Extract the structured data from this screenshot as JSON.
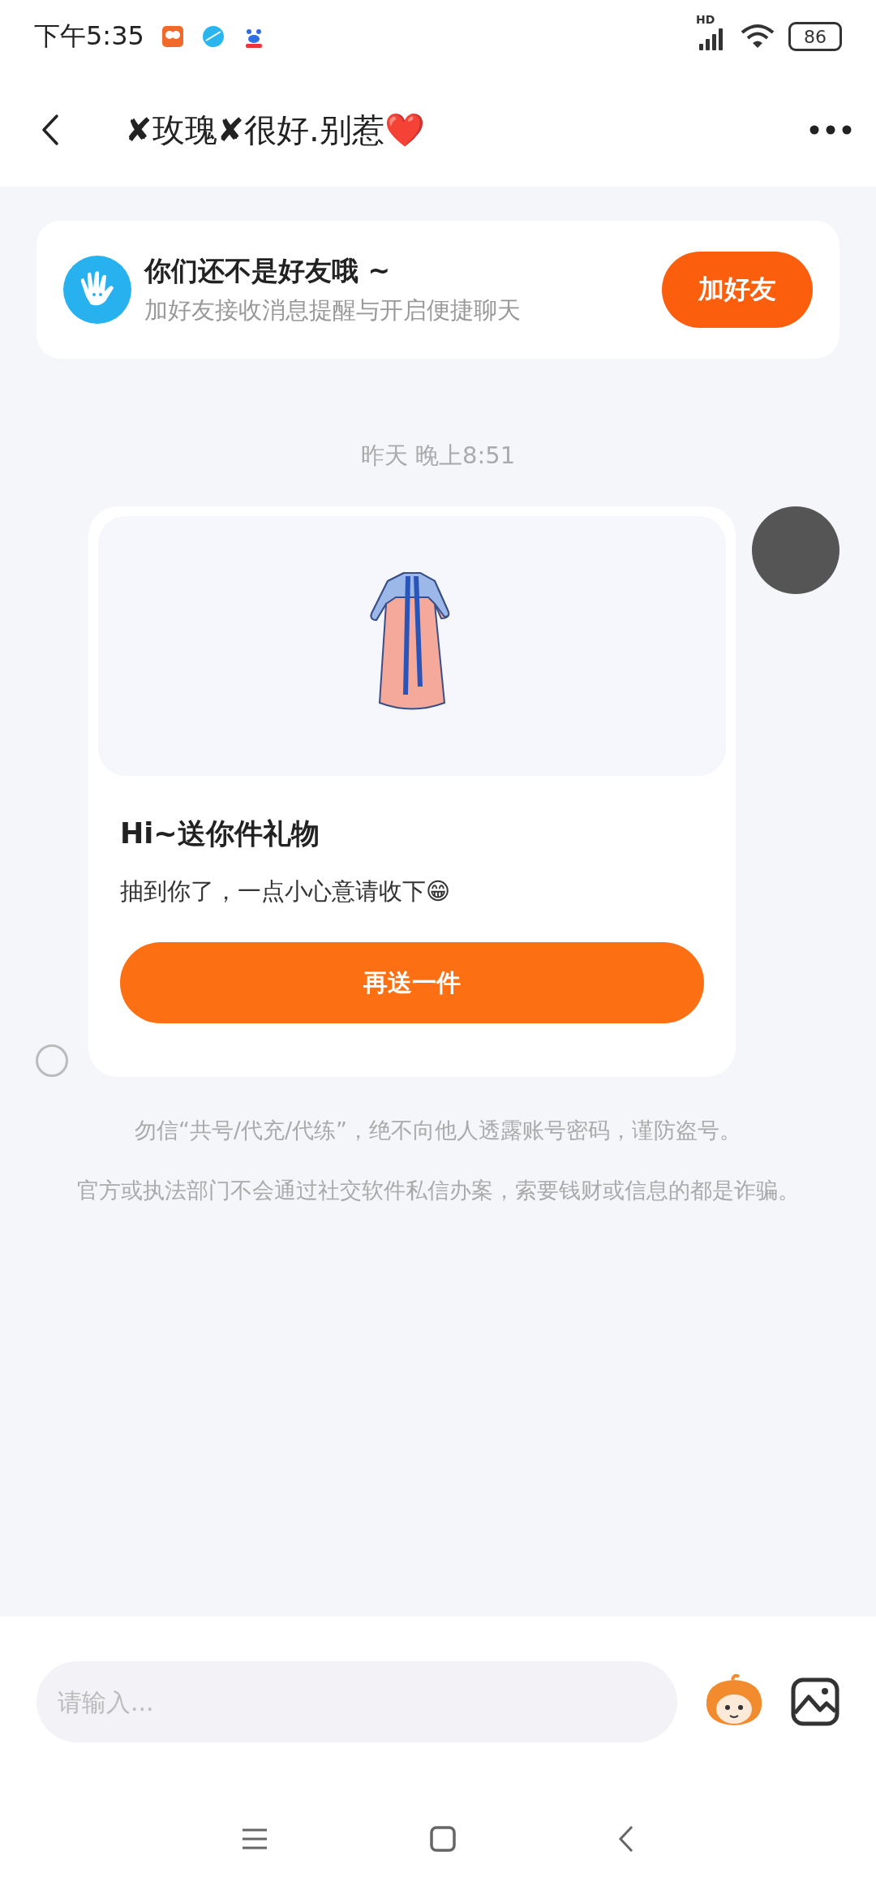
{
  "status_bar": {
    "time": "下午5:35",
    "network": "HD",
    "battery": "86"
  },
  "header": {
    "title": "✘玫瑰✘很好.别惹❤️"
  },
  "friend_banner": {
    "title": "你们还不是好友哦 ~",
    "subtitle": "加好友接收消息提醒与开启便捷聊天",
    "button": "加好友"
  },
  "timestamp": "昨天 晚上8:51",
  "message": {
    "selected": false,
    "title": "Hi~送你件礼物",
    "text": "抽到你了，一点小心意请收下😁",
    "button": "再送一件"
  },
  "notices": [
    "勿信“共号/代充/代练”，绝不向他人透露账号密码，谨防盗号。",
    "官方或执法部门不会通过社交软件私信办案，索要钱财或信息的都是诈骗。"
  ],
  "composer": {
    "placeholder": "请输入..."
  }
}
